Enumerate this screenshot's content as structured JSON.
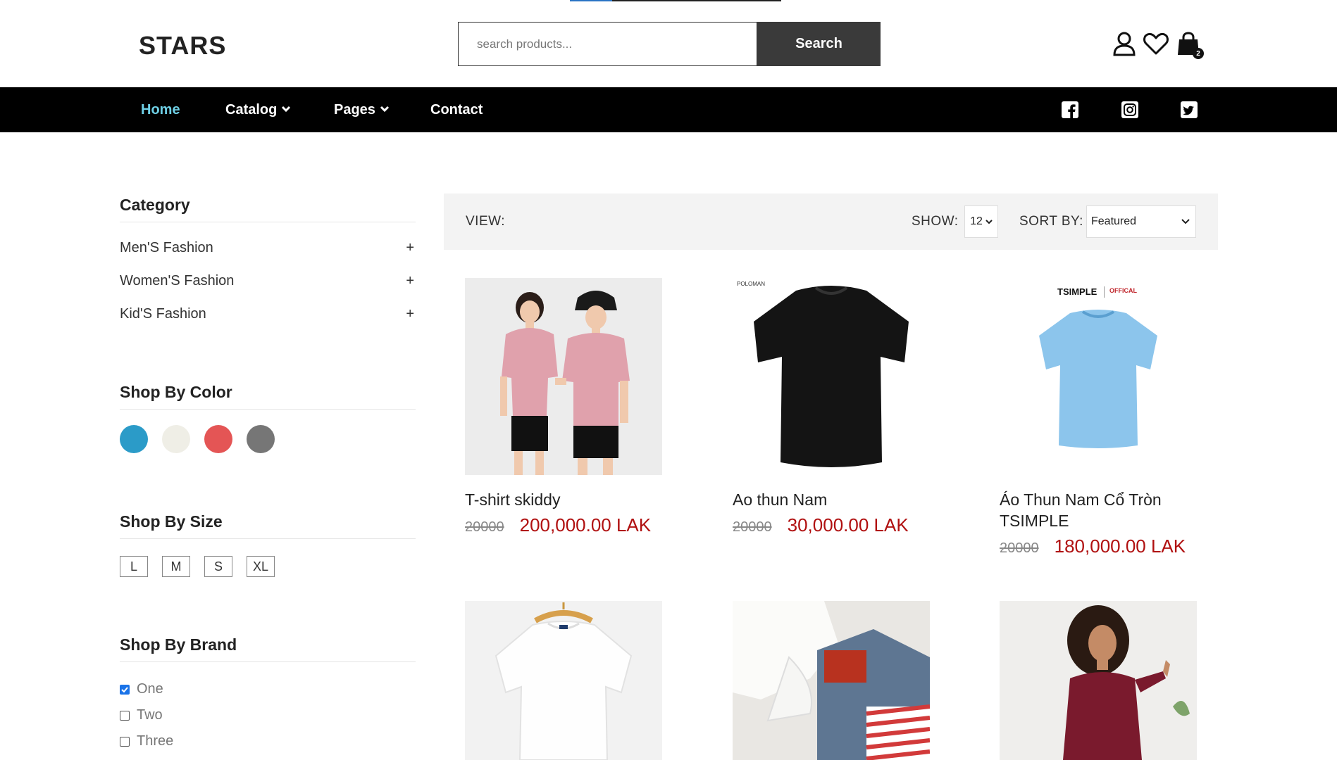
{
  "header": {
    "logo": "STARS",
    "search_placeholder": "search products...",
    "search_label": "Search",
    "cart_count": "2"
  },
  "nav": {
    "items": [
      {
        "label": "Home"
      },
      {
        "label": "Catalog"
      },
      {
        "label": "Pages"
      },
      {
        "label": "Contact"
      }
    ],
    "social": [
      "facebook-icon",
      "instagram-icon",
      "twitter-icon"
    ]
  },
  "sidebar": {
    "category_title": "Category",
    "categories": [
      "Men'S Fashion",
      "Women'S Fashion",
      "Kid'S Fashion"
    ],
    "color_title": "Shop By Color",
    "colors": [
      "#2b9bc8",
      "#efeee6",
      "#e45555",
      "#767676"
    ],
    "size_title": "Shop By Size",
    "sizes": [
      "L",
      "M",
      "S",
      "XL"
    ],
    "brand_title": "Shop By Brand",
    "brands": [
      {
        "label": "One",
        "checked": true
      },
      {
        "label": "Two",
        "checked": false
      },
      {
        "label": "Three",
        "checked": false
      }
    ]
  },
  "toolbar": {
    "view_label": "VIEW:",
    "show_label": "SHOW:",
    "show_value": "12",
    "sort_label": "SORT BY:",
    "sort_value": "Featured"
  },
  "products": [
    {
      "name": "T-shirt skiddy",
      "old_price": "20000",
      "price": "200,000.00 LAK"
    },
    {
      "name": "Ao thun Nam",
      "old_price": "20000",
      "price": "30,000.00 LAK"
    },
    {
      "name": "Áo Thun Nam Cổ Tròn TSIMPLE",
      "old_price": "20000",
      "price": "180,000.00 LAK"
    },
    {
      "name": "",
      "old_price": "",
      "price": ""
    },
    {
      "name": "",
      "old_price": "",
      "price": ""
    },
    {
      "name": "",
      "old_price": "",
      "price": ""
    }
  ],
  "product_labels": {
    "polomax": "POLOMAN",
    "tsimple": "TSIMPLE",
    "official": "OFFICAL"
  }
}
